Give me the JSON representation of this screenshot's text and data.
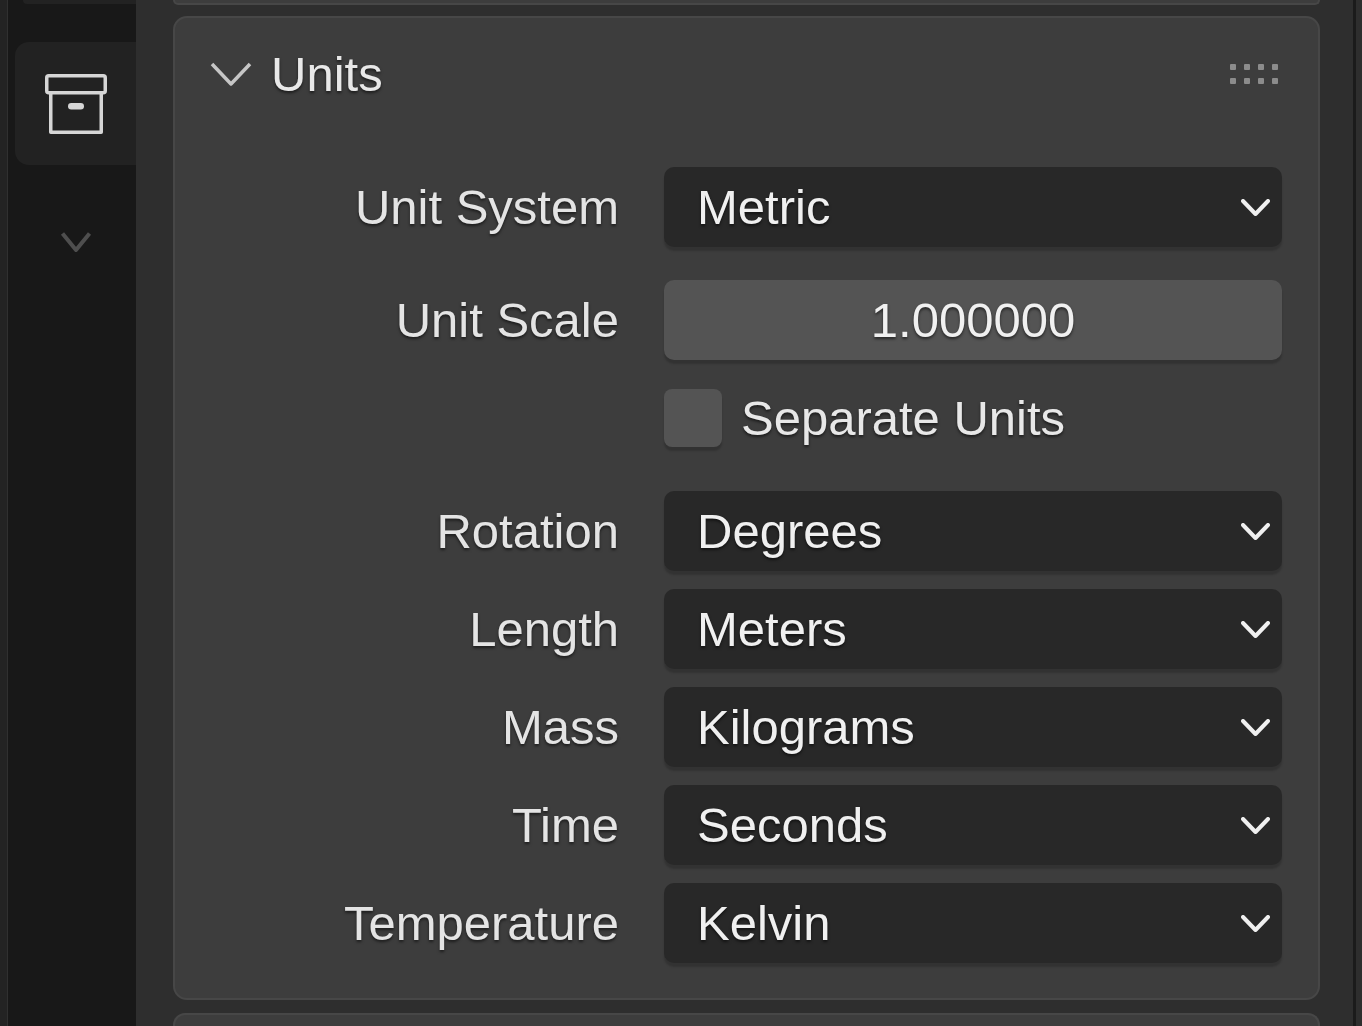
{
  "sidebar": {
    "tabs": [
      {
        "selected": true
      }
    ]
  },
  "panel": {
    "title": "Units",
    "expanded": true,
    "groups": [
      {
        "rows": [
          {
            "kind": "dropdown",
            "label": "Unit System",
            "value": "Metric"
          }
        ]
      },
      {
        "rows": [
          {
            "kind": "number",
            "label": "Unit Scale",
            "value": "1.000000"
          },
          {
            "kind": "checkbox",
            "label": "Separate Units",
            "checked": false
          }
        ]
      },
      {
        "rows": [
          {
            "kind": "dropdown",
            "label": "Rotation",
            "value": "Degrees"
          },
          {
            "kind": "dropdown",
            "label": "Length",
            "value": "Meters"
          },
          {
            "kind": "dropdown",
            "label": "Mass",
            "value": "Kilograms"
          },
          {
            "kind": "dropdown",
            "label": "Time",
            "value": "Seconds"
          },
          {
            "kind": "dropdown",
            "label": "Temperature",
            "value": "Kelvin"
          }
        ]
      }
    ]
  }
}
